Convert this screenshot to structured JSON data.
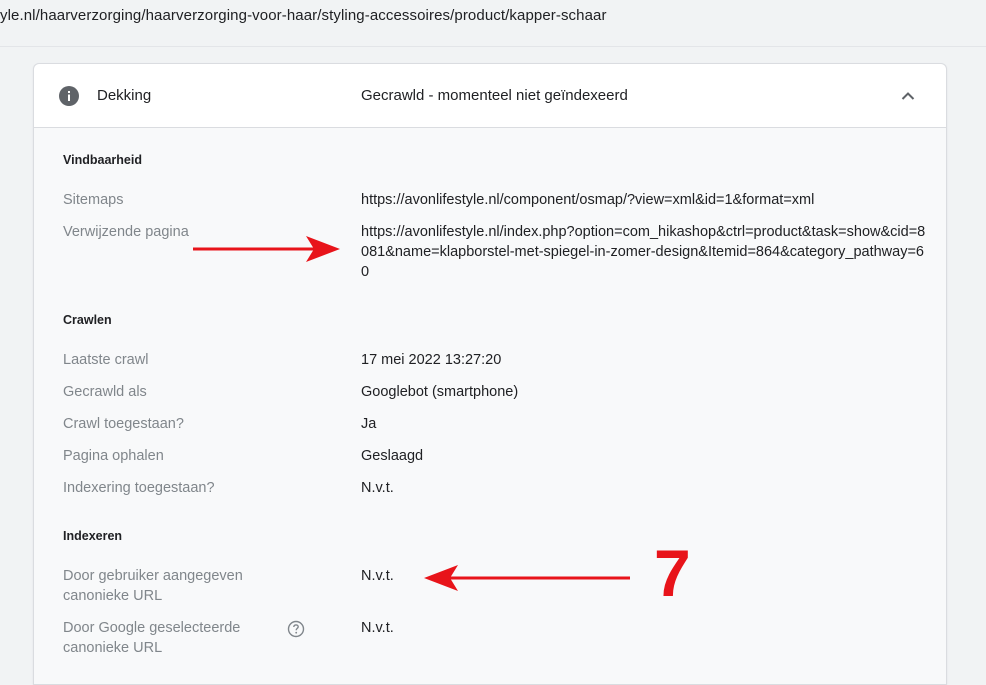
{
  "browser": {
    "url": "yle.nl/haarverzorging/haarverzorging-voor-haar/styling-accessoires/product/kapper-schaar"
  },
  "card": {
    "header_label": "Dekking",
    "header_value": "Gecrawld - momenteel niet geïndexeerd",
    "sections": {
      "vindbaarheid": {
        "title": "Vindbaarheid",
        "sitemaps_label": "Sitemaps",
        "sitemaps_value": "https://avonlifestyle.nl/component/osmap/?view=xml&id=1&format=xml",
        "referring_label": "Verwijzende pagina",
        "referring_value": "https://avonlifestyle.nl/index.php?option=com_hikashop&ctrl=product&task=show&cid=8081&name=klapborstel-met-spiegel-in-zomer-design&Itemid=864&category_pathway=60"
      },
      "crawlen": {
        "title": "Crawlen",
        "rows": [
          {
            "label": "Laatste crawl",
            "value": "17 mei 2022 13:27:20"
          },
          {
            "label": "Gecrawld als",
            "value": "Googlebot (smartphone)"
          },
          {
            "label": "Crawl toegestaan?",
            "value": "Ja"
          },
          {
            "label": "Pagina ophalen",
            "value": "Geslaagd"
          },
          {
            "label": "Indexering toegestaan?",
            "value": "N.v.t."
          }
        ]
      },
      "indexeren": {
        "title": "Indexeren",
        "user_canonical_label": "Door gebruiker aangegeven canonieke URL",
        "user_canonical_value": "N.v.t.",
        "google_canonical_label": "Door Google geselecteerde canonieke URL",
        "google_canonical_value": "N.v.t."
      }
    }
  },
  "annotation": {
    "number": "7",
    "color": "#e8141a"
  },
  "icons": [
    "info-icon",
    "chevron-up-icon",
    "help-icon"
  ]
}
